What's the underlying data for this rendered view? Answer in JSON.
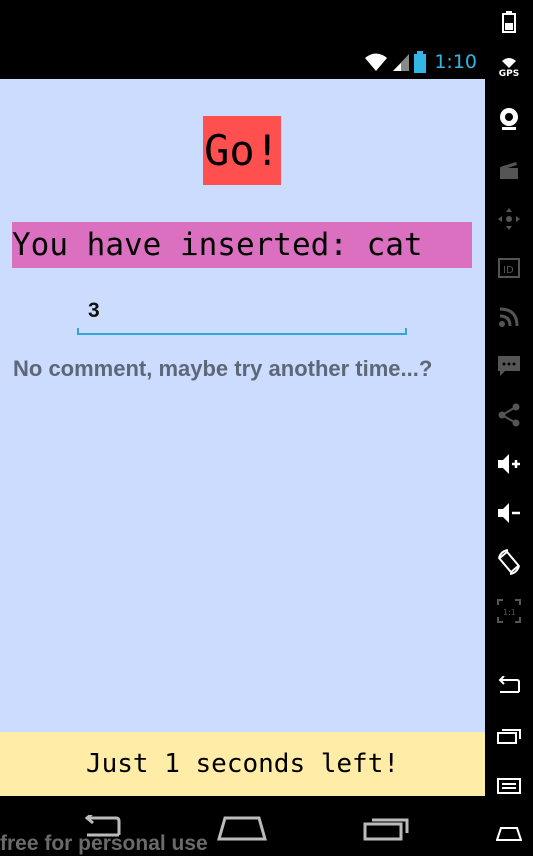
{
  "status_bar": {
    "time": "1:10",
    "icons": [
      "wifi-icon",
      "cell-signal-icon",
      "battery-icon"
    ]
  },
  "app": {
    "go_label": "Go!",
    "inserted_text": "You have inserted: cat",
    "number_value": "3",
    "comment": "No comment, maybe try another time...?",
    "timer_text": "Just 1 seconds left!"
  },
  "nav_bar": {
    "buttons": [
      "back-icon",
      "home-icon",
      "recents-icon"
    ]
  },
  "watermark": "free for personal use",
  "emulator_panel": {
    "gps_label": "GPS",
    "icons": [
      "battery-icon",
      "gps-icon",
      "camera-icon",
      "clapper-icon",
      "dpad-icon",
      "id-icon",
      "rss-icon",
      "sms-icon",
      "share-icon",
      "volume-up-icon",
      "volume-down-icon",
      "rotate-icon",
      "scale-icon",
      "back-icon",
      "home-icon",
      "recents-icon",
      "menu-icon"
    ]
  },
  "colors": {
    "app_background": "#ccdcff",
    "go_button": "#ff4f4f",
    "inserted_bar": "#dc70c0",
    "timer_bar": "#ffeca6",
    "clock": "#33b5e5",
    "input_underline": "#33a7d8",
    "comment_text": "#5d6777"
  }
}
